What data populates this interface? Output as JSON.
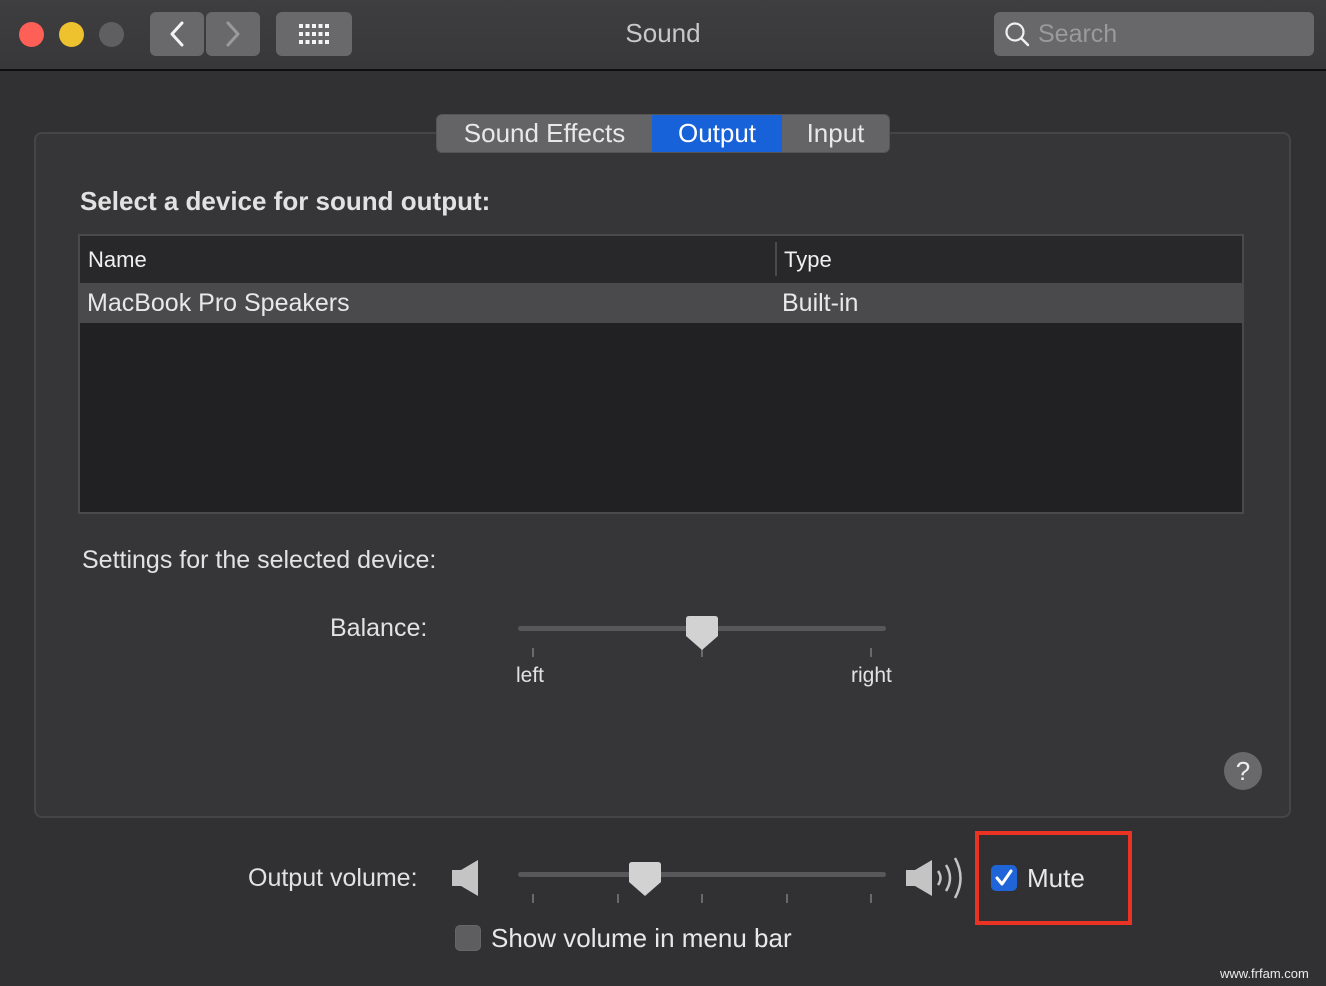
{
  "window": {
    "title": "Sound",
    "search_placeholder": "Search"
  },
  "tabs": [
    {
      "label": "Sound Effects",
      "selected": false
    },
    {
      "label": "Output",
      "selected": true
    },
    {
      "label": "Input",
      "selected": false
    }
  ],
  "output": {
    "heading": "Select a device for sound output:",
    "columns": [
      "Name",
      "Type"
    ],
    "devices": [
      {
        "name": "MacBook Pro Speakers",
        "type": "Built-in",
        "selected": true
      }
    ],
    "settings_label": "Settings for the selected device:",
    "balance": {
      "label": "Balance:",
      "left_label": "left",
      "right_label": "right",
      "value": 0.5
    }
  },
  "volume": {
    "label": "Output volume:",
    "value": 0.33,
    "mute_label": "Mute",
    "mute_checked": true,
    "show_in_menu_bar_label": "Show volume in menu bar",
    "show_in_menu_bar_checked": false
  },
  "help_label": "?",
  "watermark": "www.frfam.com",
  "colors": {
    "accent": "#1862d9",
    "highlight_box": "#ea3323"
  }
}
